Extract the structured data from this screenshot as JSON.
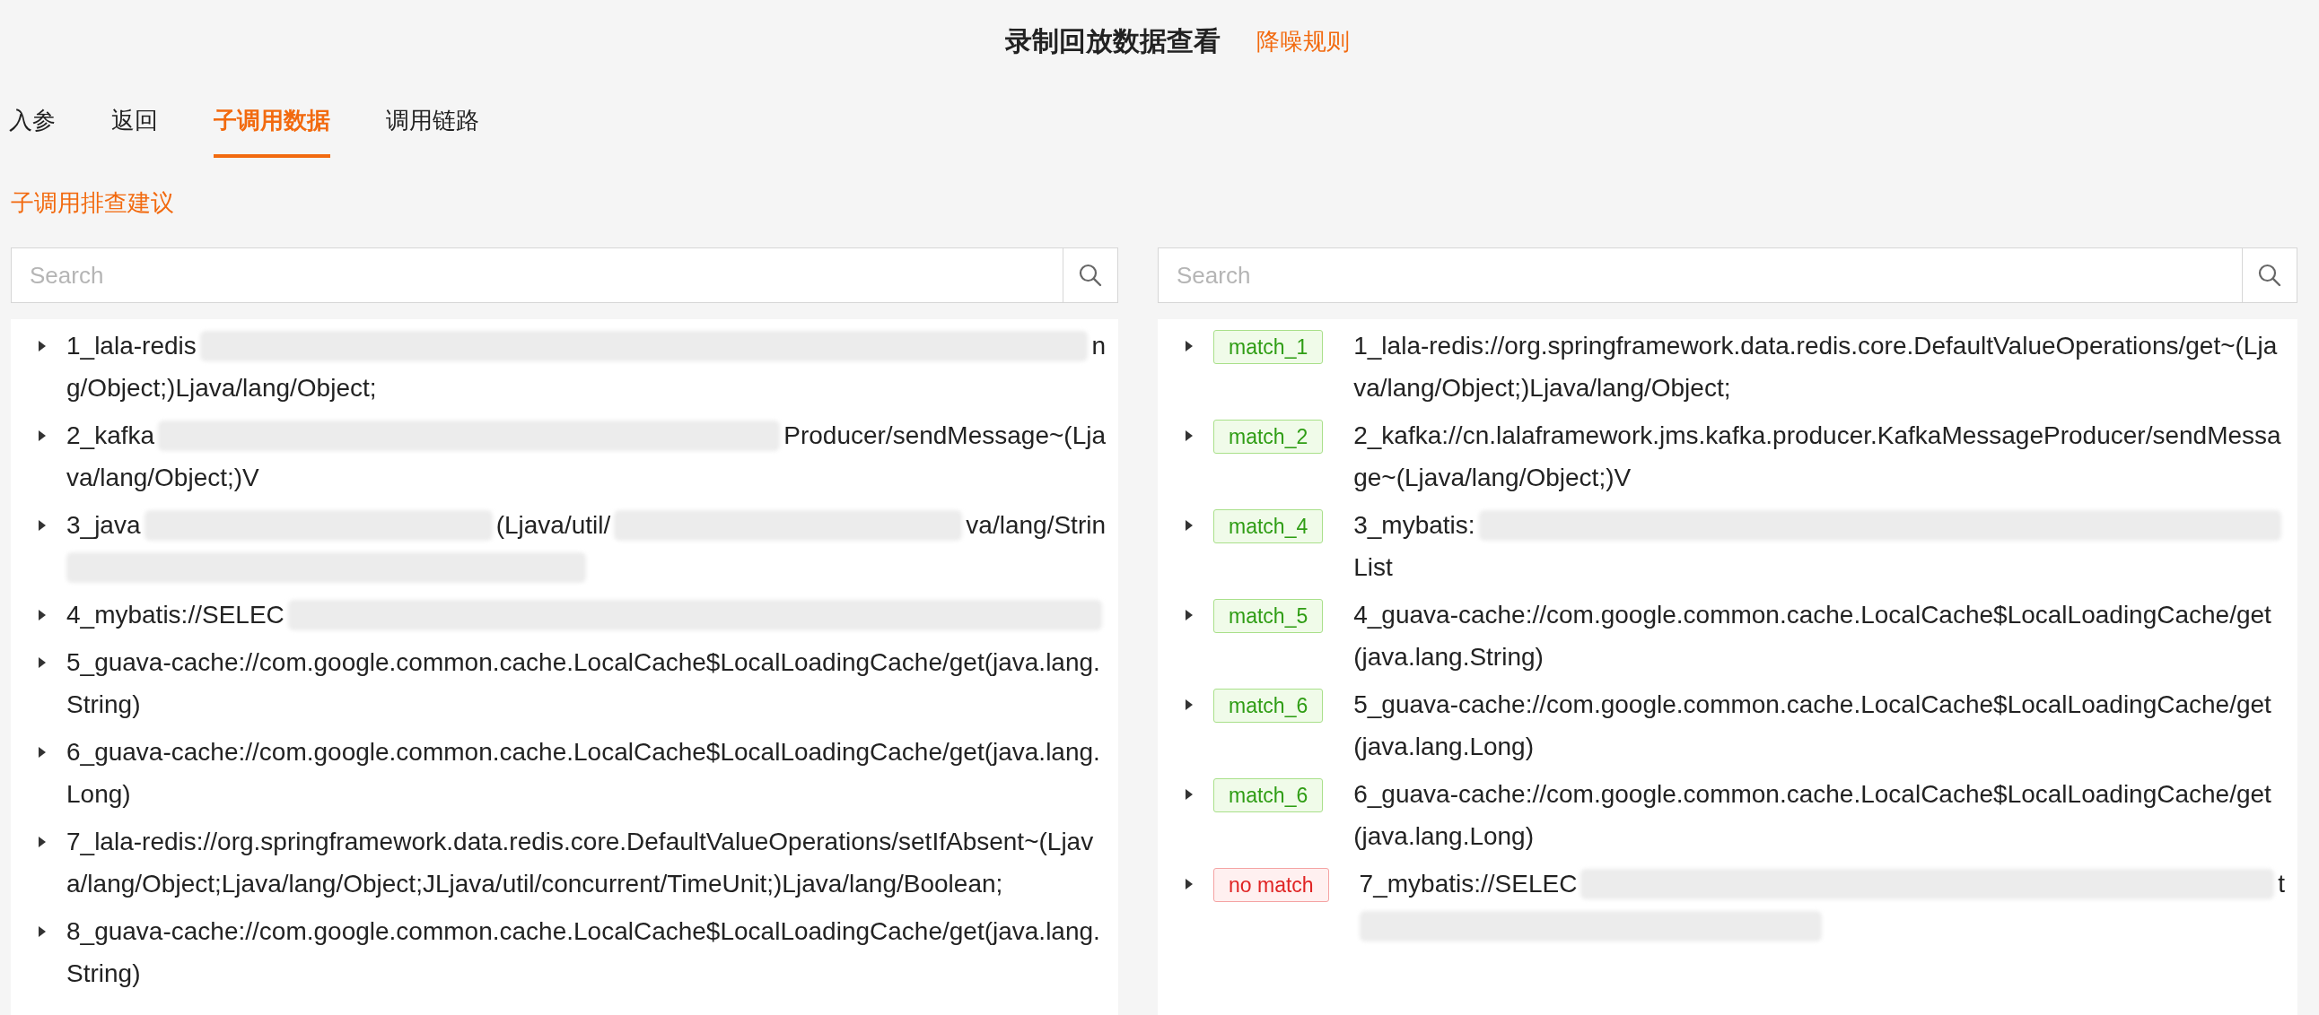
{
  "header": {
    "title": "录制回放数据查看",
    "link": "降噪规则"
  },
  "tabs": [
    {
      "label": "入参",
      "selected": false
    },
    {
      "label": "返回",
      "selected": false
    },
    {
      "label": "子调用数据",
      "selected": true
    },
    {
      "label": "调用链路",
      "selected": false
    }
  ],
  "section_title": "子调用排查建议",
  "panels": [
    {
      "search": {
        "placeholder": "Search"
      },
      "items": [
        {
          "lines": [
            [
              {
                "kind": "text",
                "text": "1_lala-redis"
              },
              {
                "kind": "redacted"
              },
              {
                "kind": "text",
                "text": "n"
              }
            ],
            [
              {
                "kind": "text",
                "text": "g/Object;)Ljava/lang/Object;"
              }
            ]
          ]
        },
        {
          "lines": [
            [
              {
                "kind": "text",
                "text": "2_kafka"
              },
              {
                "kind": "redacted"
              },
              {
                "kind": "text",
                "text": "Producer/sendMessage~(Lja"
              }
            ],
            [
              {
                "kind": "text",
                "text": "va/lang/Object;)V"
              }
            ]
          ]
        },
        {
          "lines": [
            [
              {
                "kind": "text",
                "text": "3_java"
              },
              {
                "kind": "redacted"
              },
              {
                "kind": "text",
                "text": "(Ljava/util/"
              },
              {
                "kind": "redacted"
              },
              {
                "kind": "text",
                "text": "va/lang/Strin"
              }
            ],
            [
              {
                "kind": "redacted"
              }
            ]
          ]
        },
        {
          "lines": [
            [
              {
                "kind": "text",
                "text": "4_mybatis://SELEC"
              },
              {
                "kind": "redacted"
              }
            ]
          ]
        },
        {
          "lines": [
            [
              {
                "kind": "text",
                "text": "5_guava-cache://com.google.common.cache.LocalCache$LocalLoadingCache/get(java.lang.String)"
              }
            ]
          ]
        },
        {
          "lines": [
            [
              {
                "kind": "text",
                "text": "6_guava-cache://com.google.common.cache.LocalCache$LocalLoadingCache/get(java.lang.Long)"
              }
            ]
          ]
        },
        {
          "lines": [
            [
              {
                "kind": "text",
                "text": "7_lala-redis://org.springframework.data.redis.core.DefaultValueOperations/setIfAbsent~(Ljava/lang/Object;Ljava/lang/Object;JLjava/util/concurrent/TimeUnit;)Ljava/lang/Boolean;"
              }
            ]
          ]
        },
        {
          "lines": [
            [
              {
                "kind": "text",
                "text": "8_guava-cache://com.google.common.cache.LocalCache$LocalLoadingCache/get(java.lang.String)"
              }
            ]
          ]
        }
      ]
    },
    {
      "search": {
        "placeholder": "Search"
      },
      "items": [
        {
          "tag": {
            "text": "match_1",
            "matched": true
          },
          "lines": [
            [
              {
                "kind": "text",
                "text": "1_lala-redis://org.springframework.data.redis.core.DefaultValueOperations/get~(Ljava/lang/Object;)Ljava/lang/Object;"
              }
            ]
          ]
        },
        {
          "tag": {
            "text": "match_2",
            "matched": true
          },
          "lines": [
            [
              {
                "kind": "text",
                "text": "2_kafka://cn.lalaframework.jms.kafka.producer.KafkaMessageProducer/sendMessage~(Ljava/lang/Object;)V"
              }
            ]
          ]
        },
        {
          "tag": {
            "text": "match_4",
            "matched": true
          },
          "lines": [
            [
              {
                "kind": "text",
                "text": "3_mybatis:"
              },
              {
                "kind": "redacted"
              }
            ],
            [
              {
                "kind": "text",
                "text": "List"
              }
            ]
          ]
        },
        {
          "tag": {
            "text": "match_5",
            "matched": true
          },
          "lines": [
            [
              {
                "kind": "text",
                "text": "4_guava-cache://com.google.common.cache.LocalCache$LocalLoadingCache/get(java.lang.String)"
              }
            ]
          ]
        },
        {
          "tag": {
            "text": "match_6",
            "matched": true
          },
          "lines": [
            [
              {
                "kind": "text",
                "text": "5_guava-cache://com.google.common.cache.LocalCache$LocalLoadingCache/get(java.lang.Long)"
              }
            ]
          ]
        },
        {
          "tag": {
            "text": "match_6",
            "matched": true
          },
          "lines": [
            [
              {
                "kind": "text",
                "text": "6_guava-cache://com.google.common.cache.LocalCache$LocalLoadingCache/get(java.lang.Long)"
              }
            ]
          ]
        },
        {
          "tag": {
            "text": "no match",
            "matched": false
          },
          "lines": [
            [
              {
                "kind": "text",
                "text": "7_mybatis://SELEC"
              },
              {
                "kind": "redacted"
              },
              {
                "kind": "text",
                "text": "t"
              }
            ],
            [
              {
                "kind": "redacted"
              }
            ]
          ]
        }
      ]
    }
  ]
}
